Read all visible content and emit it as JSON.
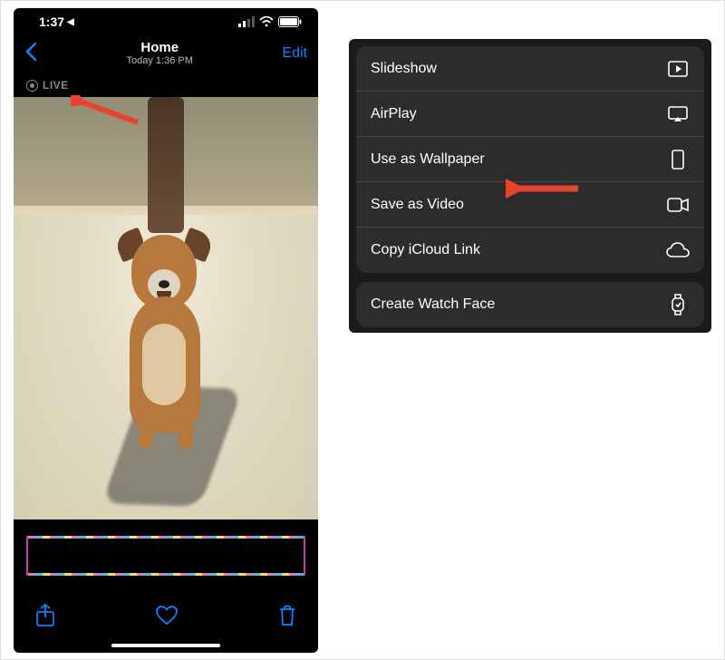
{
  "status_bar": {
    "time": "1:37",
    "location_arrow": "◀︎"
  },
  "nav": {
    "title": "Home",
    "subtitle": "Today 1:36 PM",
    "edit_label": "Edit"
  },
  "live_badge": "LIVE",
  "share_sheet": {
    "group1": [
      {
        "label": "Slideshow",
        "icon": "play-rect-icon"
      },
      {
        "label": "AirPlay",
        "icon": "airplay-icon"
      },
      {
        "label": "Use as Wallpaper",
        "icon": "rect-portrait-icon"
      },
      {
        "label": "Save as Video",
        "icon": "video-camera-icon"
      },
      {
        "label": "Copy iCloud Link",
        "icon": "cloud-icon"
      }
    ],
    "group2": [
      {
        "label": "Create Watch Face",
        "icon": "watch-icon"
      }
    ]
  },
  "colors": {
    "accent": "#0a84ff",
    "arrow": "#e8432e"
  }
}
